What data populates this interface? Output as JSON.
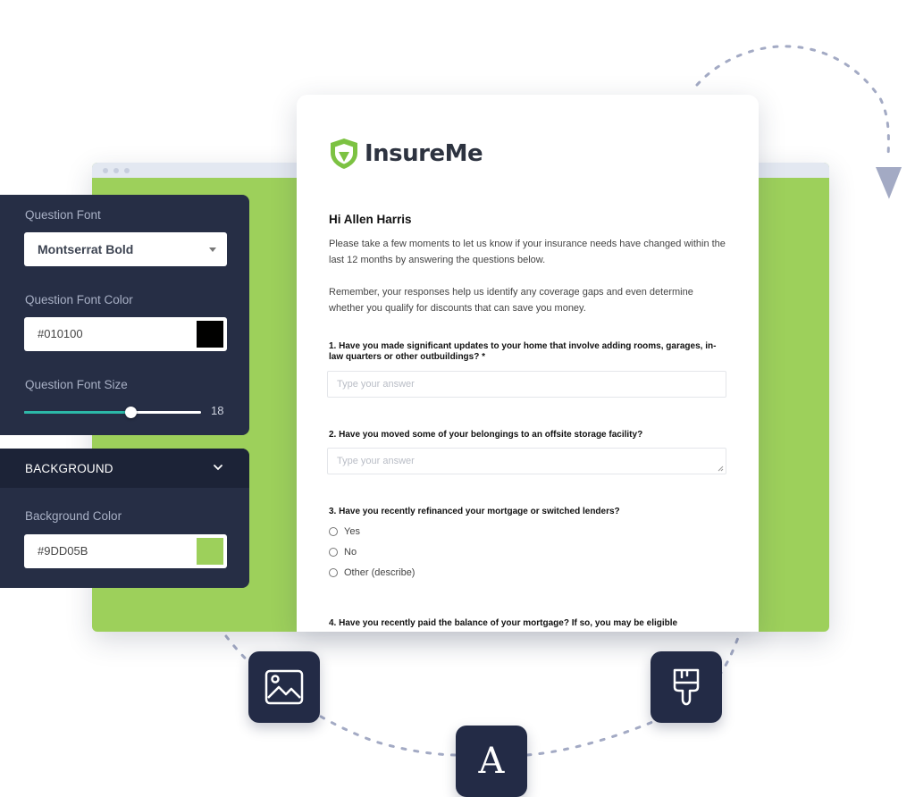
{
  "brand": {
    "name": "InsureMe",
    "accent": "#7cc242"
  },
  "form": {
    "greeting": "Hi Allen Harris",
    "intro1": "Please take a few moments to let us know if your insurance needs have changed within the last 12 months by answering the questions below.",
    "intro2": "Remember, your responses help us identify any coverage gaps and even determine whether you qualify for discounts that can save you money.",
    "questions": [
      {
        "label": "1. Have you made significant updates to your home that involve adding rooms, garages, in-law quarters or other outbuildings? *",
        "placeholder": "Type your answer"
      },
      {
        "label": "2. Have you moved some of your belongings to an offsite storage facility?",
        "placeholder": "Type your answer"
      },
      {
        "label": "3. Have you recently refinanced your mortgage or switched lenders?",
        "options": [
          "Yes",
          "No",
          "Other (describe)"
        ]
      },
      {
        "label": "4. Have you recently paid the balance of your mortgage? If so, you may be eligible"
      }
    ]
  },
  "font_panel": {
    "font_label": "Question Font",
    "font_value": "Montserrat Bold",
    "color_label": "Question Font Color",
    "color_value": "#010100",
    "size_label": "Question Font Size",
    "size_value": "18",
    "size_level": 0.6
  },
  "background_panel": {
    "section_title": "BACKGROUND",
    "color_label": "Background Color",
    "color_value": "#9DD05B"
  },
  "tiles": [
    "image-icon",
    "text-font-icon",
    "paint-brush-icon"
  ],
  "tile_letter": "A"
}
